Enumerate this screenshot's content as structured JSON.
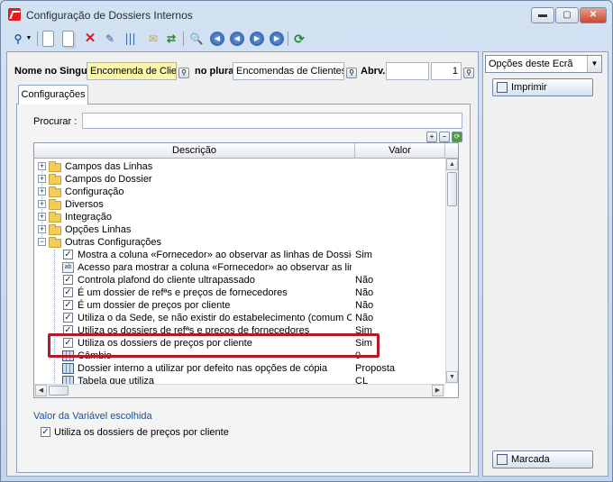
{
  "window": {
    "title": "Configuração de Dossiers Internos",
    "min_glyph": "▬",
    "max_glyph": "▢",
    "close_glyph": "✕"
  },
  "header": {
    "singular_label": "Nome no Singular",
    "singular_value": "Encomenda de Cliente",
    "plural_label": "no plural",
    "plural_value": "Encomendas de Clientes",
    "abrv_label": "Abrv.",
    "abrv_value": "",
    "number_value": "1"
  },
  "tab": {
    "label": "Configurações"
  },
  "search": {
    "label": "Procurar :",
    "value": ""
  },
  "grid": {
    "col_description": "Descrição",
    "col_value": "Valor",
    "folders": [
      "Campos das Linhas",
      "Campos do Dossier",
      "Configuração",
      "Diversos",
      "Integração",
      "Opções Linhas",
      "Outras Configurações"
    ],
    "items": [
      {
        "icon": "checkbox",
        "text": "Mostra a coluna «Fornecedor» ao observar as linhas de Dossiers a p...",
        "value": "Sim"
      },
      {
        "icon": "text",
        "text": "Acesso para mostrar a coluna «Fornecedor» ao observar as linhas de...",
        "value": ""
      },
      {
        "icon": "checkbox",
        "text": "Controla plafond do cliente ultrapassado",
        "value": "Não"
      },
      {
        "icon": "checkbox",
        "text": "É um dossier de refªs e preços de fornecedores",
        "value": "Não"
      },
      {
        "icon": "checkbox",
        "text": "É um dossier de preços por cliente",
        "value": "Não"
      },
      {
        "icon": "checkbox",
        "text": "Utiliza o da Sede, se não existir do estabelecimento (comum Clientes\\...",
        "value": "Não"
      },
      {
        "icon": "checkbox",
        "text": "Utiliza os dossiers de refªs e preços de fornecedores",
        "value": "Sim"
      },
      {
        "icon": "checkbox",
        "text": "Utiliza os dossiers de preços por cliente",
        "value": "Sim"
      },
      {
        "icon": "table",
        "text": "Câmbio",
        "value": "0"
      },
      {
        "icon": "table",
        "text": "Dossier interno a utilizar por defeito nas opções de cópia",
        "value": "Proposta"
      },
      {
        "icon": "table",
        "text": "Tabela que utiliza",
        "value": "CL"
      }
    ]
  },
  "bottom": {
    "variable_link": "Valor da Variável escolhida",
    "checkbox_label": "Utiliza os dossiers de preços por cliente"
  },
  "right_panel": {
    "options_combo": "Opções deste Ecrã",
    "print_button": "Imprimir",
    "mark_button": "Marcada"
  },
  "colors": {
    "highlight": "#b2192a",
    "selected_field": "#fbf6a8",
    "link": "#1a4fa0"
  }
}
